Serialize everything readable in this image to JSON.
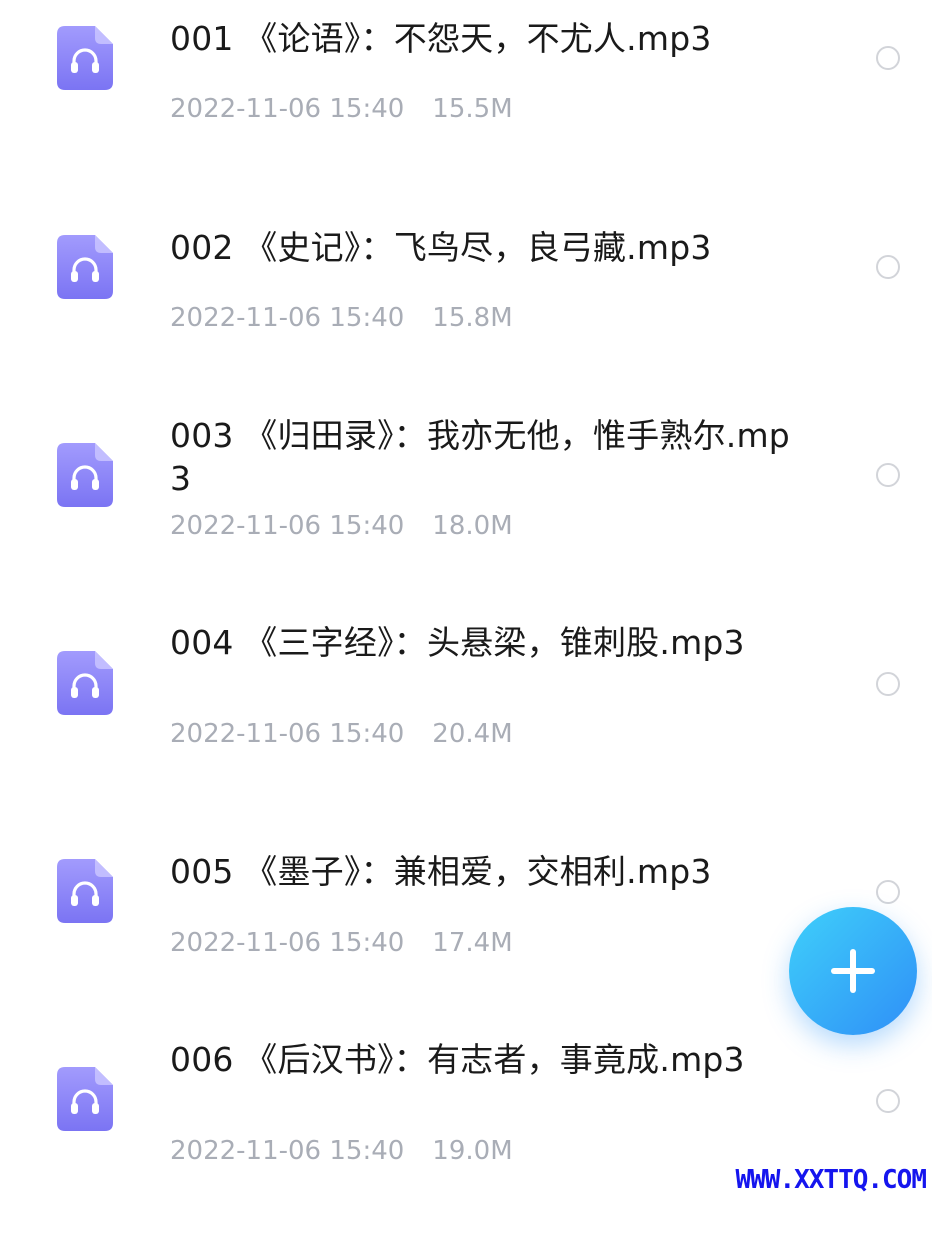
{
  "files": [
    {
      "name": "001 《论语》：不怨天，不尤人.mp3",
      "date": "2022-11-06 15:40",
      "size": "15.5M"
    },
    {
      "name": "002 《史记》：飞鸟尽，良弓藏.mp3",
      "date": "2022-11-06 15:40",
      "size": "15.8M"
    },
    {
      "name": "003 《归田录》：我亦无他，惟手熟尔.mp3",
      "date": "2022-11-06 15:40",
      "size": "18.0M"
    },
    {
      "name": "004 《三字经》：头悬梁，锥刺股.mp3",
      "date": "2022-11-06 15:40",
      "size": "20.4M"
    },
    {
      "name": "005 《墨子》：兼相爱，交相利.mp3",
      "date": "2022-11-06 15:40",
      "size": "17.4M"
    },
    {
      "name": "006 《后汉书》：有志者，事竟成.mp3",
      "date": "2022-11-06 15:40",
      "size": "19.0M"
    }
  ],
  "icons": {
    "file": "audio-file-icon",
    "add": "plus-icon"
  },
  "colors": {
    "icon_gradient_top": "#a29bfd",
    "icon_gradient_bottom": "#7b74f3",
    "fab_gradient_start": "#3fd0fa",
    "fab_gradient_end": "#2f8ff7",
    "meta_text": "#a9adb6",
    "watermark": "#1515ee"
  },
  "watermark": "WWW.XXTTQ.COM"
}
